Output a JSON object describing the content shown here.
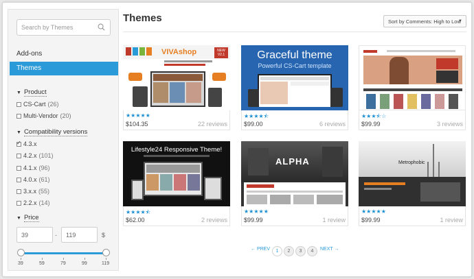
{
  "search": {
    "placeholder": "Search by Themes"
  },
  "categories": [
    {
      "label": "Add-ons"
    },
    {
      "label": "Themes",
      "active": true
    }
  ],
  "filters": {
    "product": {
      "title": "Product",
      "items": [
        {
          "label": "CS-Cart",
          "count": "(26)"
        },
        {
          "label": "Multi-Vendor",
          "count": "(20)"
        }
      ]
    },
    "compat": {
      "title": "Compatibility versions",
      "items": [
        {
          "label": "4.3.x",
          "count": "",
          "checked": true
        },
        {
          "label": "4.2.x",
          "count": "(101)"
        },
        {
          "label": "4.1.x",
          "count": "(96)"
        },
        {
          "label": "4.0.x",
          "count": "(61)"
        },
        {
          "label": "3.x.x",
          "count": "(55)"
        },
        {
          "label": "2.2.x",
          "count": "(14)"
        }
      ]
    },
    "price": {
      "title": "Price",
      "min": "39",
      "max": "119",
      "currency": "$",
      "separator": "-",
      "ticks": [
        "39",
        "59",
        "79",
        "99",
        "119"
      ]
    }
  },
  "page": {
    "title": "Themes",
    "sort_label": "Sort by Comments: High to Low"
  },
  "products": [
    {
      "price": "$104.35",
      "reviews": "22 reviews",
      "rating": 5,
      "thumb_text": "VIVAshop",
      "thumb_sub": "NEW V2.1"
    },
    {
      "price": "$99.00",
      "reviews": "6 reviews",
      "rating": 4.5,
      "thumb_text": "Graceful theme",
      "thumb_sub": "Powerful CS-Cart template"
    },
    {
      "price": "$99.99",
      "reviews": "3 reviews",
      "rating": 3.5,
      "thumb_text": "",
      "thumb_sub": ""
    },
    {
      "price": "$62.00",
      "reviews": "2 reviews",
      "rating": 4.5,
      "thumb_text": "Lifestyle24 Responsive Theme!",
      "thumb_sub": ""
    },
    {
      "price": "$99.99",
      "reviews": "1 review",
      "rating": 5,
      "thumb_text": "ALPHA",
      "thumb_sub": ""
    },
    {
      "price": "$99.99",
      "reviews": "1 review",
      "rating": 5,
      "thumb_text": "Metrophobic",
      "thumb_sub": ""
    }
  ],
  "pagination": {
    "prev": "← PREV",
    "next": "NEXT →",
    "pages": [
      "1",
      "2",
      "3",
      "4"
    ],
    "current": "1"
  },
  "colors": {
    "accent": "#2a9ad8",
    "star": "#1b8fd3"
  }
}
